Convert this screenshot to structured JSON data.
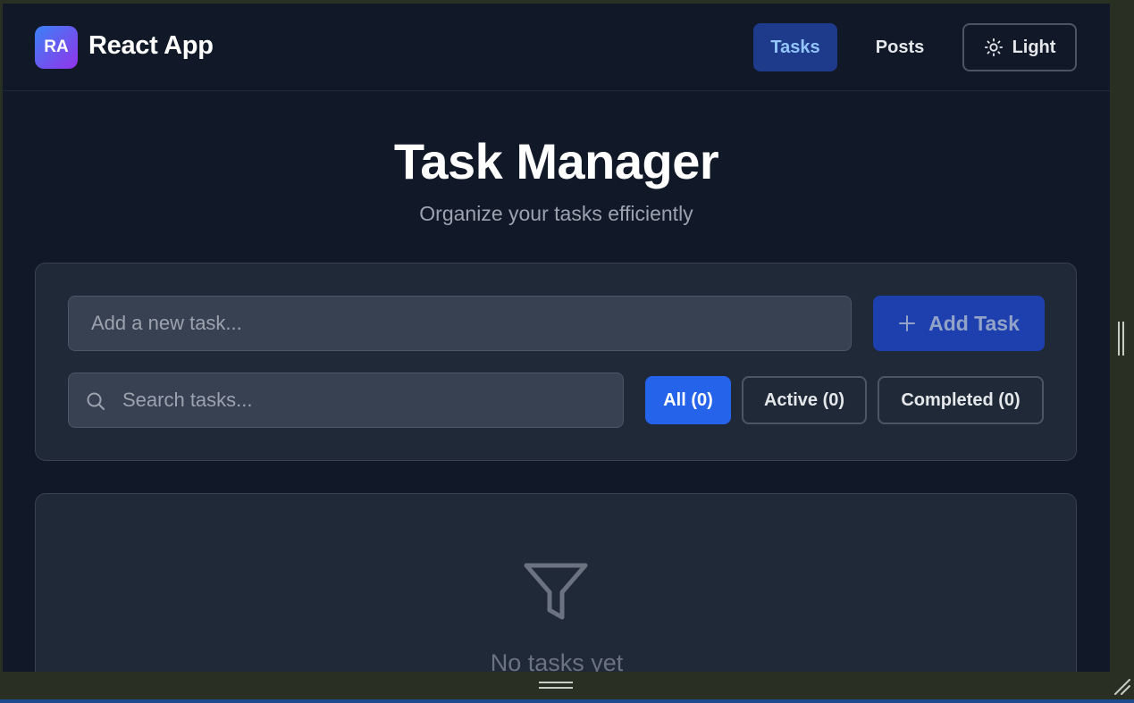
{
  "navbar": {
    "logo_initials": "RA",
    "app_name": "React App",
    "links": [
      {
        "label": "Tasks",
        "active": true
      },
      {
        "label": "Posts",
        "active": false
      }
    ],
    "theme_toggle": {
      "label": "Light",
      "icon": "sun-icon"
    }
  },
  "header": {
    "title": "Task Manager",
    "subtitle": "Organize your tasks efficiently"
  },
  "form": {
    "new_task_placeholder": "Add a new task...",
    "new_task_value": "",
    "add_button_label": "Add Task",
    "add_button_icon": "plus-icon",
    "search_placeholder": "Search tasks...",
    "search_value": "",
    "search_icon": "search-icon"
  },
  "filters": [
    {
      "label": "All (0)",
      "selected": true
    },
    {
      "label": "Active (0)",
      "selected": false
    },
    {
      "label": "Completed (0)",
      "selected": false
    }
  ],
  "empty_state": {
    "icon": "filter-icon",
    "message": "No tasks yet"
  },
  "colors": {
    "background": "#111827",
    "card": "#1f2937",
    "accent": "#2563eb",
    "active_nav": "#1e3a8a",
    "frame": "#2a2f24"
  }
}
